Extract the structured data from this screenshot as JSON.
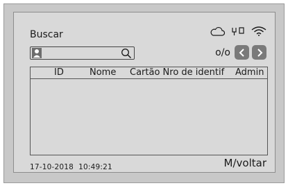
{
  "screen": {
    "title": "Buscar"
  },
  "status_icons": [
    "cloud-icon",
    "network-icon",
    "wifi-icon"
  ],
  "search": {
    "value": ""
  },
  "pager": {
    "count": "o/o"
  },
  "table": {
    "columns": [
      "ID",
      "Nome",
      "Cartão Nro de identif",
      "Admin"
    ],
    "rows": []
  },
  "footer": {
    "date": "17-10-2018",
    "time": "10:49:21",
    "back_label": "M/voltar"
  }
}
